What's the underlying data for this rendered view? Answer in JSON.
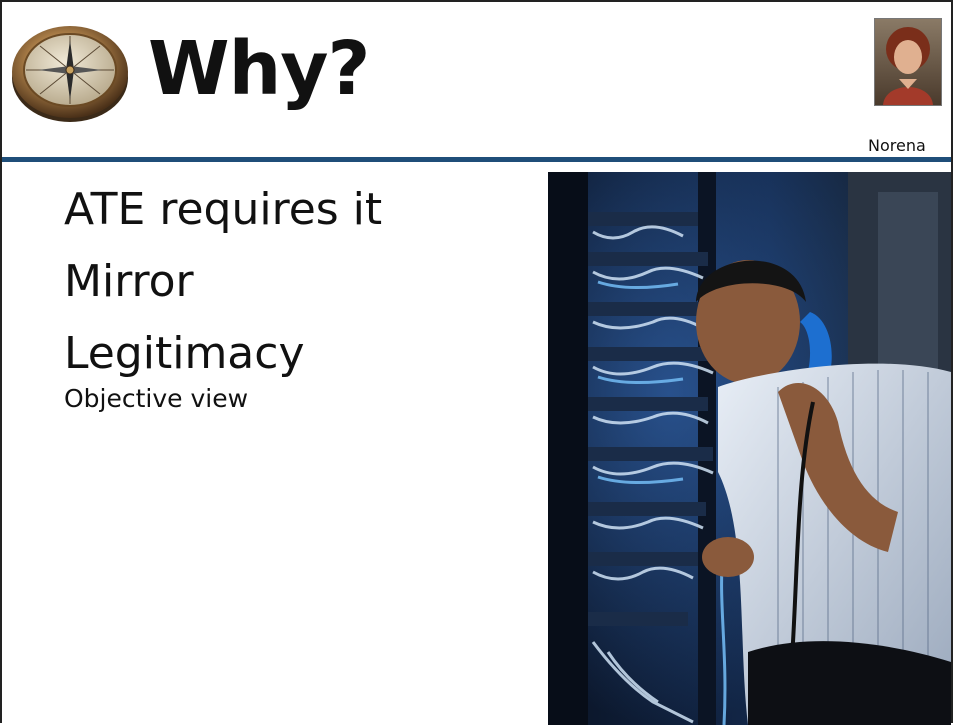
{
  "slide": {
    "title": "Why?",
    "presenter": {
      "name": "Norena",
      "photo_icon": "presenter-portrait"
    },
    "logo_icon": "compass-icon",
    "accent_color": "#1f4e79",
    "bullets": [
      "ATE requires it",
      "Mirror",
      "Legitimacy"
    ],
    "sub_bullet": "Objective view",
    "illustration": "technician-server-rack-photo"
  }
}
